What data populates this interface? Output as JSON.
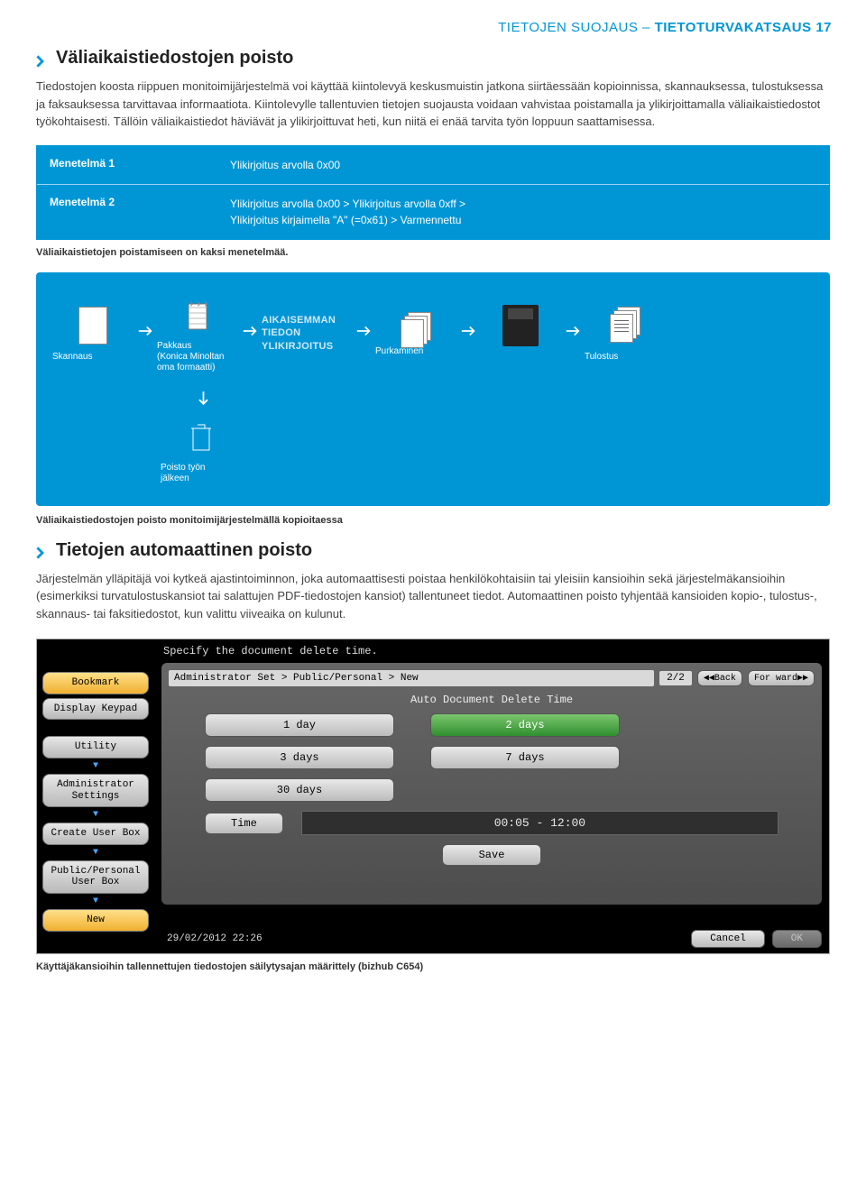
{
  "header": {
    "light": "TIETOJEN SUOJAUS – ",
    "bold": "TIETOTURVAKATSAUS",
    "page": "17"
  },
  "sec1": {
    "title": "Väliaikaistiedostojen poisto",
    "body": "Tiedostojen koosta riippuen monitoimijärjestelmä voi käyttää kiintolevyä keskusmuistin jatkona siirtäessään kopioinnissa, skannauksessa, tulostuksessa ja faksauksessa tarvittavaa informaatiota. Kiintolevylle tallentuvien tietojen suojausta voidaan vahvistaa poistamalla ja ylikirjoittamalla väliaikaistiedostot työkohtaisesti. Tällöin väliaikaistiedot häviävät ja ylikirjoittuvat heti, kun niitä ei enää tarvita työn loppuun saattamisessa."
  },
  "methods": {
    "m1": {
      "label": "Menetelmä 1",
      "desc": "Ylikirjoitus arvolla 0x00"
    },
    "m2": {
      "label": "Menetelmä 2",
      "desc1": "Ylikirjoitus arvolla 0x00 > Ylikirjoitus arvolla 0xff >",
      "desc2": "Ylikirjoitus kirjaimella \"A\" (=0x61) > Varmennettu"
    },
    "caption": "Väliaikaistietojen poistamiseen on kaksi menetelmää."
  },
  "flow": {
    "scan": "Skannaus",
    "pack1": "Pakkaus",
    "pack2": "(Konica Minoltan",
    "pack3": "oma formaatti)",
    "over1": "AIKAISEMMAN",
    "over2": "TIEDON",
    "over3": "YLIKIRJOITUS",
    "unpack": "Purkaminen",
    "print": "Tulostus",
    "del1": "Poisto työn",
    "del2": "jälkeen",
    "caption": "Väliaikaistiedostojen poisto monitoimijärjestelmällä kopioitaessa"
  },
  "sec2": {
    "title": "Tietojen automaattinen poisto",
    "body": "Järjestelmän ylläpitäjä voi kytkeä ajastintoiminnon, joka automaattisesti poistaa henkilökohtaisiin tai yleisiin kansioihin sekä järjestelmäkansioihin (esimerkiksi turvatulostuskansiot tai salattujen PDF-tiedostojen kansiot) tallentuneet tiedot. Automaattinen poisto tyhjentää kansioiden kopio-, tulostus-, skannaus- tai faksitiedostot, kun valittu viiveaika on kulunut."
  },
  "device": {
    "title": "Specify the document delete time.",
    "breadcrumb": "Administrator Set > Public/Personal > New",
    "page": "2/2",
    "back": "Back",
    "forward": "For ward",
    "subtitle": "Auto Document Delete Time",
    "opts": {
      "d1": "1 day",
      "d2": "2 days",
      "d3": "3 days",
      "d7": "7 days",
      "d30": "30 days"
    },
    "time_label": "Time",
    "time_value": "00:05  -  12:00",
    "save": "Save",
    "cancel": "Cancel",
    "ok": "OK",
    "timestamp": "29/02/2012   22:26",
    "side": {
      "bookmark": "Bookmark",
      "keypad": "Display Keypad",
      "utility": "Utility",
      "admin1": "Administrator",
      "admin2": "Settings",
      "createbox": "Create User Box",
      "pp1": "Public/Personal",
      "pp2": "User Box",
      "new": "New"
    }
  },
  "final_caption": "Käyttäjäkansioihin tallennettujen tiedostojen säilytysajan määrittely (bizhub C654)"
}
